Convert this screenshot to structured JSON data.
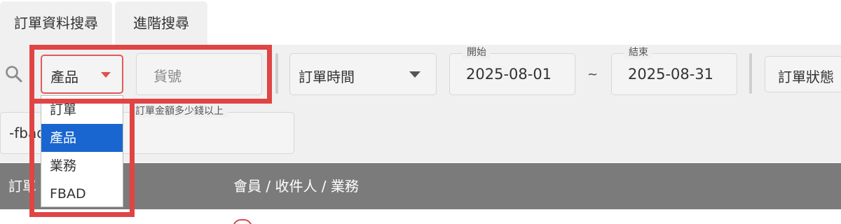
{
  "tabs": [
    {
      "label": "訂單資料搜尋"
    },
    {
      "label": "進階搜尋"
    }
  ],
  "filters": {
    "search_type": {
      "value": "產品",
      "options": [
        "訂單",
        "產品",
        "業務",
        "FBAD"
      ],
      "selected_index": 1
    },
    "item_input": {
      "placeholder": "貨號"
    },
    "time_field": {
      "value": "訂單時間"
    },
    "start_date": {
      "label": "開始",
      "value": "2025-08-01"
    },
    "range_sep": "~",
    "end_date": {
      "label": "結束",
      "value": "2025-08-31"
    },
    "status": {
      "value": "訂單狀態"
    },
    "amount": {
      "label": "訂單金額多少錢以上",
      "value": "-fbad"
    }
  },
  "table": {
    "headers": [
      "訂單",
      "會員 / 收件人 / 業務"
    ]
  },
  "colors": {
    "highlight": "#e04444",
    "selected_option": "#1a66d0",
    "header_bg": "#7b7b7b",
    "filter_bg": "#f0f0f0"
  },
  "icons": {
    "search": "search-icon",
    "dropdown_caret": "caret-down-icon"
  }
}
